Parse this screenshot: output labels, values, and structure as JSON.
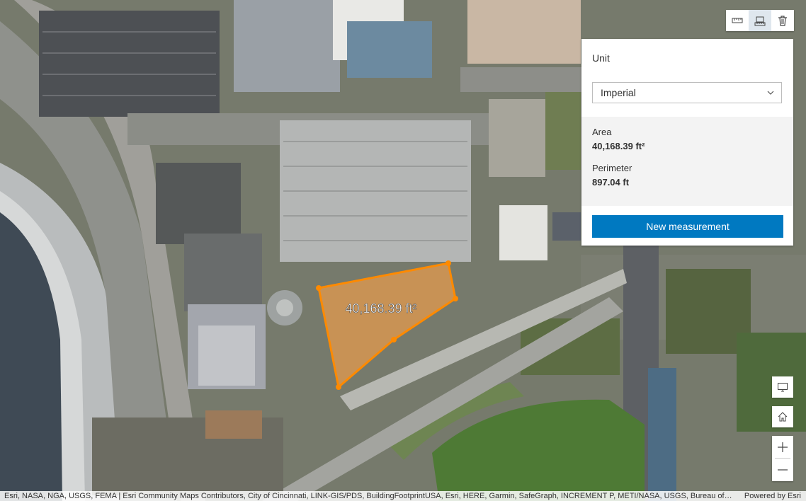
{
  "measurement": {
    "map_label": "40,168.39 ft²",
    "unit_label": "Unit",
    "unit_selected": "Imperial",
    "area_label": "Area",
    "area_value": "40,168.39 ft²",
    "perimeter_label": "Perimeter",
    "perimeter_value": "897.04 ft",
    "new_button": "New measurement"
  },
  "toolbar": {
    "icons": [
      "distance-measure-icon",
      "area-measure-icon",
      "trash-icon"
    ],
    "active": "area-measure-icon"
  },
  "map_controls": {
    "icons": [
      "screen-icon",
      "home-icon",
      "zoom-in-icon",
      "zoom-out-icon"
    ]
  },
  "attribution": {
    "text": "Esri, NASA, NGA, USGS, FEMA | Esri Community Maps Contributors, City of Cincinnati, LINK-GIS/PDS, BuildingFootprintUSA, Esri, HERE, Garmin, SafeGraph, INCREMENT P, METI/NASA, USGS, Bureau of Land Management, EPA, NPS, US Census Bureau, USDA",
    "powered": "Powered by Esri"
  },
  "colors": {
    "measure_stroke": "#ff8a00",
    "measure_fill": "#f5a04a",
    "button_blue": "#0079c1",
    "active_tool_bg": "#dfe7ee"
  }
}
